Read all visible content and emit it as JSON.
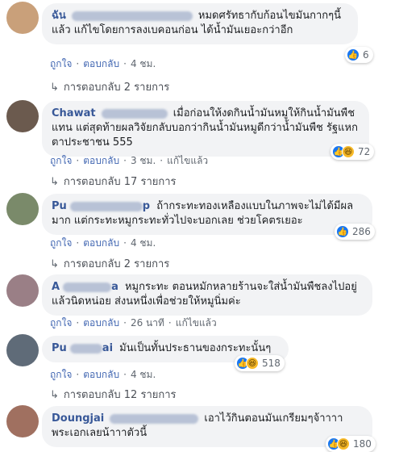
{
  "ui": {
    "like": "ถูกใจ",
    "reply": "ตอบกลับ",
    "edited": "แก้ไขแล้ว",
    "dot": "·"
  },
  "comments": [
    {
      "name": "ฉัน",
      "text": "หมดศรัทธากับก้อนไขมันกากๆนี้แล้ว แก้ไขโดยการลงเบคอนก่อน ได้น้ำมันเยอะกว่าอีก",
      "time": "4 ชม.",
      "edited": false,
      "reactions": "6",
      "reply_text": "การตอบกลับ 2 รายการ"
    },
    {
      "name": "Chawat",
      "text": "เมื่อก่อนให้งดกินน้ำมันหมูให้กินน้ำมันพืชแทน แต่สุดท้ายผลวิจัยกลับบอกว่ากินน้ำมันหมูดีกว่าน้ำมันพืช รัฐแหกตาประชาชน 555",
      "time": "3 ชม.",
      "edited": true,
      "reactions": "72",
      "reply_text": "การตอบกลับ 17 รายการ"
    },
    {
      "name": "Pu",
      "name_tail": "p",
      "text": "ถ้ากระทะทองเหลืองแบบในภาพจะไม่ได้มีผลมาก แต่กระทะหมูกระทะทั่วไปจะบอกเลย ช่วยโคตรเยอะ",
      "time": "4 ชม.",
      "edited": false,
      "reactions": "286",
      "reply_text": "การตอบกลับ 2 รายการ"
    },
    {
      "name": "A",
      "name_tail": "a",
      "text": "หมูกระทะ ตอนหมักหลายร้านจะใส่น้ำมันพืชลงไปอยู่แล้วนิดหน่อย ส่งนหนึ่งเพื่อช่วยให้หมูนิ่มค่ะ",
      "time": "26 นาที",
      "edited": true
    },
    {
      "name": "Pu",
      "name_tail": "ai",
      "text": "มันเป็นทั้นประธานของกระทะนั้นๆ",
      "time": "4 ชม.",
      "edited": false,
      "reactions": "518",
      "reply_text": "การตอบกลับ 12 รายการ"
    },
    {
      "name": "Doungjai",
      "text": "เอาไว้กินตอนมันเกรียมๆจ้าาาา พระเอกเลยน้าาาตัวนี้",
      "reactions": "180"
    }
  ],
  "colors": {
    "name": "#385898",
    "bubble": "#f2f3f5",
    "meta": "#606770",
    "like": "#1877f2",
    "haha": "#f7b928"
  }
}
